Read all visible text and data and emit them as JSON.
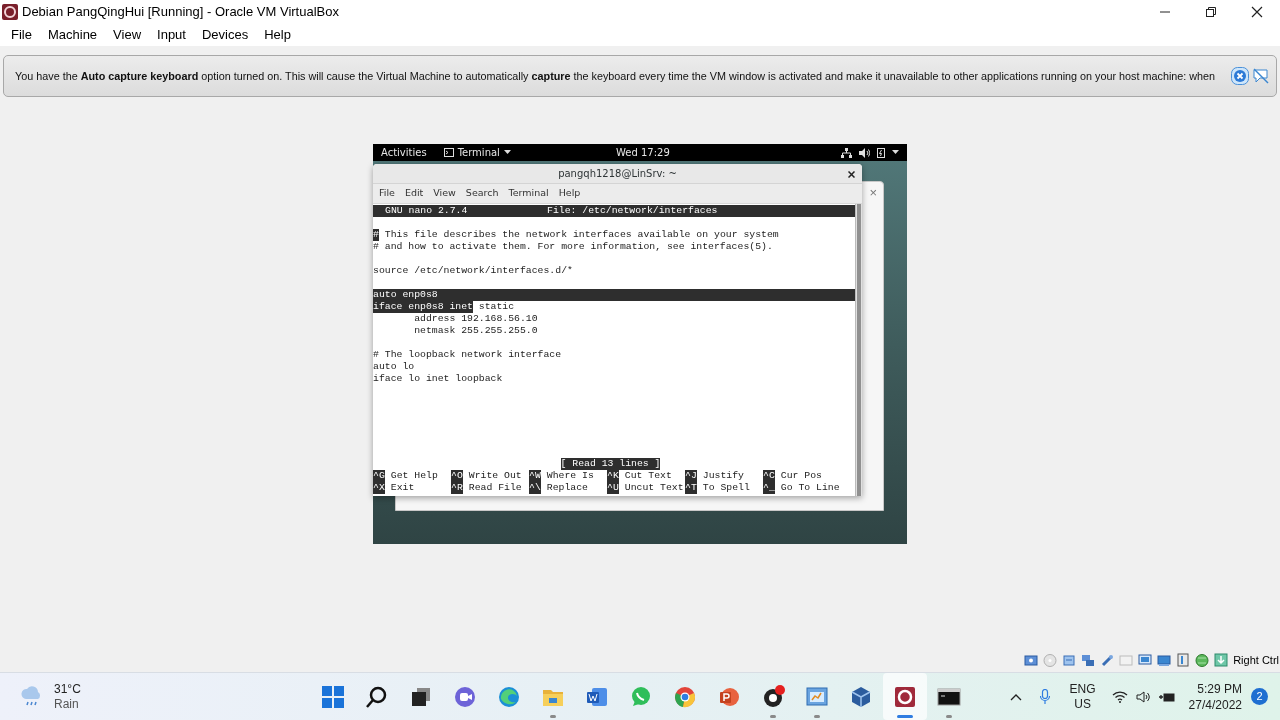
{
  "window": {
    "title": "Debian PangQingHui [Running] - Oracle VM VirtualBox"
  },
  "menu": [
    "File",
    "Machine",
    "View",
    "Input",
    "Devices",
    "Help"
  ],
  "notice": {
    "text": "You have the **Auto capture keyboard** option turned on. This will cause the Virtual Machine to automatically **capture** the keyboard every time the VM window is activated and make it unavailable to other applications running on your host machine: when"
  },
  "guest": {
    "top_bar": {
      "activities": "Activities",
      "app": "Terminal",
      "clock": "Wed 17:29"
    },
    "terminal": {
      "title": "pangqh1218@LinSrv: ~",
      "menu": [
        "File",
        "Edit",
        "View",
        "Search",
        "Terminal",
        "Help"
      ],
      "nano": {
        "version": "GNU nano 2.7.4",
        "file": "File: /etc/network/interfaces",
        "blocks": [
          [
            {
              "highlighted": false,
              "segments": [
                {
                  "text": "#",
                  "highlighted": true
                },
                {
                  "text": " This file describes the network interfaces available on your system",
                  "highlighted": false
                }
              ]
            },
            {
              "highlighted": false,
              "segments": [
                {
                  "text": "# and how to activate them. For more information, see interfaces(5).",
                  "highlighted": false
                }
              ]
            }
          ],
          [
            {
              "highlighted": false,
              "segments": [
                {
                  "text": "source /etc/network/interfaces.d/*",
                  "highlighted": false
                }
              ]
            }
          ],
          [
            {
              "highlighted": true,
              "segments": [
                {
                  "text": "auto enp0s8",
                  "highlighted": true
                }
              ]
            },
            {
              "highlighted": false,
              "segments": [
                {
                  "text": "iface enp0s8 inet",
                  "highlighted": true
                },
                {
                  "text": " static",
                  "highlighted": false
                }
              ]
            },
            {
              "highlighted": false,
              "segments": [
                {
                  "text": "       address 192.168.56.10",
                  "highlighted": false
                }
              ]
            },
            {
              "highlighted": false,
              "segments": [
                {
                  "text": "       netmask 255.255.255.0",
                  "highlighted": false
                }
              ]
            }
          ],
          [
            {
              "highlighted": false,
              "segments": [
                {
                  "text": "# The loopback network interface",
                  "highlighted": false
                }
              ]
            },
            {
              "highlighted": false,
              "segments": [
                {
                  "text": "auto lo",
                  "highlighted": false
                }
              ]
            },
            {
              "highlighted": false,
              "segments": [
                {
                  "text": "iface lo inet loopback",
                  "highlighted": false
                }
              ]
            }
          ]
        ],
        "status": "[ Read 13 lines ]",
        "shortcuts": [
          [
            {
              "key": "^G",
              "label": "Get Help"
            },
            {
              "key": "^O",
              "label": "Write Out"
            },
            {
              "key": "^W",
              "label": "Where Is"
            },
            {
              "key": "^K",
              "label": "Cut Text"
            },
            {
              "key": "^J",
              "label": "Justify"
            },
            {
              "key": "^C",
              "label": "Cur Pos"
            }
          ],
          [
            {
              "key": "^X",
              "label": "Exit"
            },
            {
              "key": "^R",
              "label": "Read File"
            },
            {
              "key": "^\\",
              "label": "Replace"
            },
            {
              "key": "^U",
              "label": "Uncut Text"
            },
            {
              "key": "^T",
              "label": "To Spell"
            },
            {
              "key": "^_",
              "label": "Go To Line"
            }
          ]
        ]
      }
    },
    "back_window": {
      "close": "×"
    }
  },
  "status_bar": {
    "host_key": "Right Ctrl"
  },
  "taskbar": {
    "weather": {
      "temperature": "31°C",
      "condition": "Rain"
    },
    "apps": [
      {
        "running": false,
        "selected": false
      },
      {
        "running": false,
        "selected": false
      },
      {
        "running": false,
        "selected": false
      },
      {
        "running": false,
        "selected": false
      },
      {
        "running": false,
        "selected": false
      },
      {
        "running": true,
        "selected": false
      },
      {
        "running": false,
        "selected": false
      },
      {
        "running": false,
        "selected": false
      },
      {
        "running": false,
        "selected": false
      },
      {
        "running": false,
        "selected": false
      },
      {
        "running": true,
        "selected": false
      },
      {
        "running": true,
        "selected": false
      },
      {
        "running": false,
        "selected": false
      },
      {
        "running": true,
        "selected": true
      },
      {
        "running": true,
        "selected": false
      }
    ],
    "language": "ENG",
    "region": "US",
    "time": "5:29 PM",
    "date": "27/4/2022",
    "notifications": "2"
  }
}
